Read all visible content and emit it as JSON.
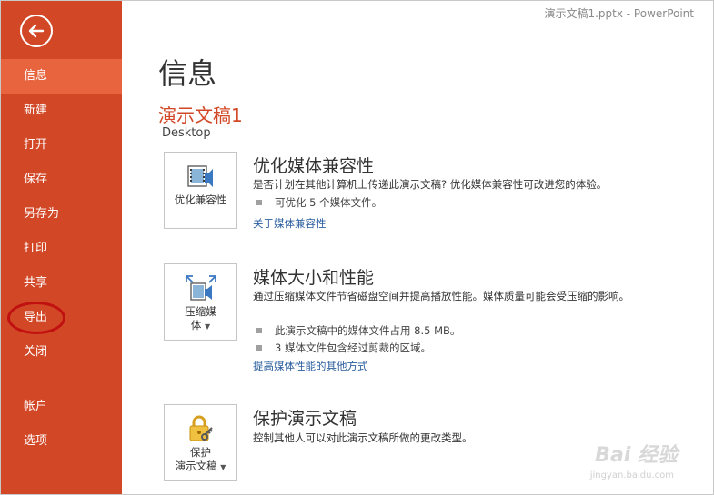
{
  "window": {
    "title": "演示文稿1.pptx - PowerPoint"
  },
  "sidebar": {
    "back_icon": "back-arrow-icon",
    "items": [
      {
        "label": "信息",
        "active": true
      },
      {
        "label": "新建"
      },
      {
        "label": "打开"
      },
      {
        "label": "保存"
      },
      {
        "label": "另存为"
      },
      {
        "label": "打印"
      },
      {
        "label": "共享"
      },
      {
        "label": "导出"
      },
      {
        "label": "关闭"
      }
    ],
    "bottom_items": [
      {
        "label": "帐户"
      },
      {
        "label": "选项"
      }
    ],
    "colors": {
      "background": "#d24726",
      "active": "#e8643f",
      "highlight_ring": "#c01010"
    }
  },
  "main": {
    "page_title": "信息",
    "doc_name": "演示文稿1",
    "doc_location": "Desktop",
    "sections": [
      {
        "tile_label": "优化兼容性",
        "heading": "优化媒体兼容性",
        "description": "是否计划在其他计算机上传递此演示文稿? 优化媒体兼容性可改进您的体验。",
        "bullets": [
          "可优化 5 个媒体文件。"
        ],
        "link": "关于媒体兼容性"
      },
      {
        "tile_label_1": "压缩媒",
        "tile_label_2": "体",
        "heading": "媒体大小和性能",
        "description": "通过压缩媒体文件节省磁盘空间并提高播放性能。媒体质量可能会受压缩的影响。",
        "bullets": [
          "此演示文稿中的媒体文件占用 8.5 MB。",
          "3 媒体文件包含经过剪裁的区域。"
        ],
        "link": "提高媒体性能的其他方式"
      },
      {
        "tile_label_1": "保护",
        "tile_label_2": "演示文稿",
        "heading": "保护演示文稿",
        "description": "控制其他人可以对此演示文稿所做的更改类型。"
      }
    ]
  },
  "watermark": {
    "text": "Bai 经验",
    "sub": "jingyan.baidu.com"
  }
}
